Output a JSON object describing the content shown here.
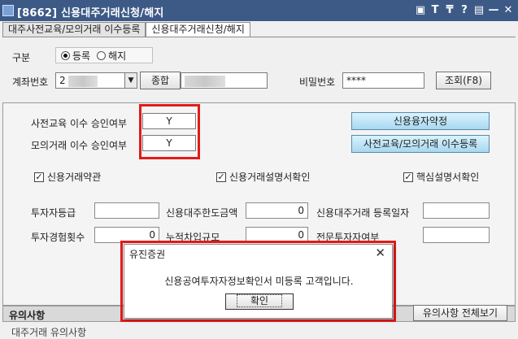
{
  "window": {
    "title": "[8662] 신용대주거래신청/해지",
    "toolbar_icons": [
      "▣",
      "T",
      "₸",
      "?",
      "▤",
      "—",
      "✕"
    ]
  },
  "tabs": [
    "대주사전교육/모의거래 이수등록",
    "신용대주거래신청/해지"
  ],
  "form": {
    "gubun_label": "구분",
    "radio_register": "등록",
    "radio_cancel": "해지",
    "account_label": "계좌번호",
    "account_prefix": "2",
    "account_type": "종합",
    "password_label": "비밀번호",
    "password_value": "****",
    "query_button": "조회(F8)"
  },
  "approvals": {
    "edu_label": "사전교육 이수 승인여부",
    "edu_value": "Y",
    "mock_label": "모의거래 이수 승인여부",
    "mock_value": "Y",
    "credit_agreement_button": "신용융자약정",
    "edu_register_button": "사전교육/모의거래 이수등록"
  },
  "checks": {
    "c1": "신용거래약관",
    "c2": "신용거래설명서확인",
    "c3": "핵심설명서확인"
  },
  "fields": {
    "investor_grade": "투자자등급",
    "short_limit": "신용대주한도금액",
    "short_limit_value": "0",
    "register_date": "신용대주거래 등록일자",
    "experience_count": "투자경험횟수",
    "experience_value": "0",
    "cumulative_scale": "누적차입규모",
    "cumulative_value": "0",
    "professional": "전문투자자여부"
  },
  "notice": {
    "title": "유의사항",
    "view_all_button": "유의사항 전체보기",
    "text": "대주거래 유의사항"
  },
  "dialog": {
    "title": "유진증권",
    "message": "신용공여투자자정보확인서 미등록 고객입니다.",
    "ok": "확인"
  }
}
